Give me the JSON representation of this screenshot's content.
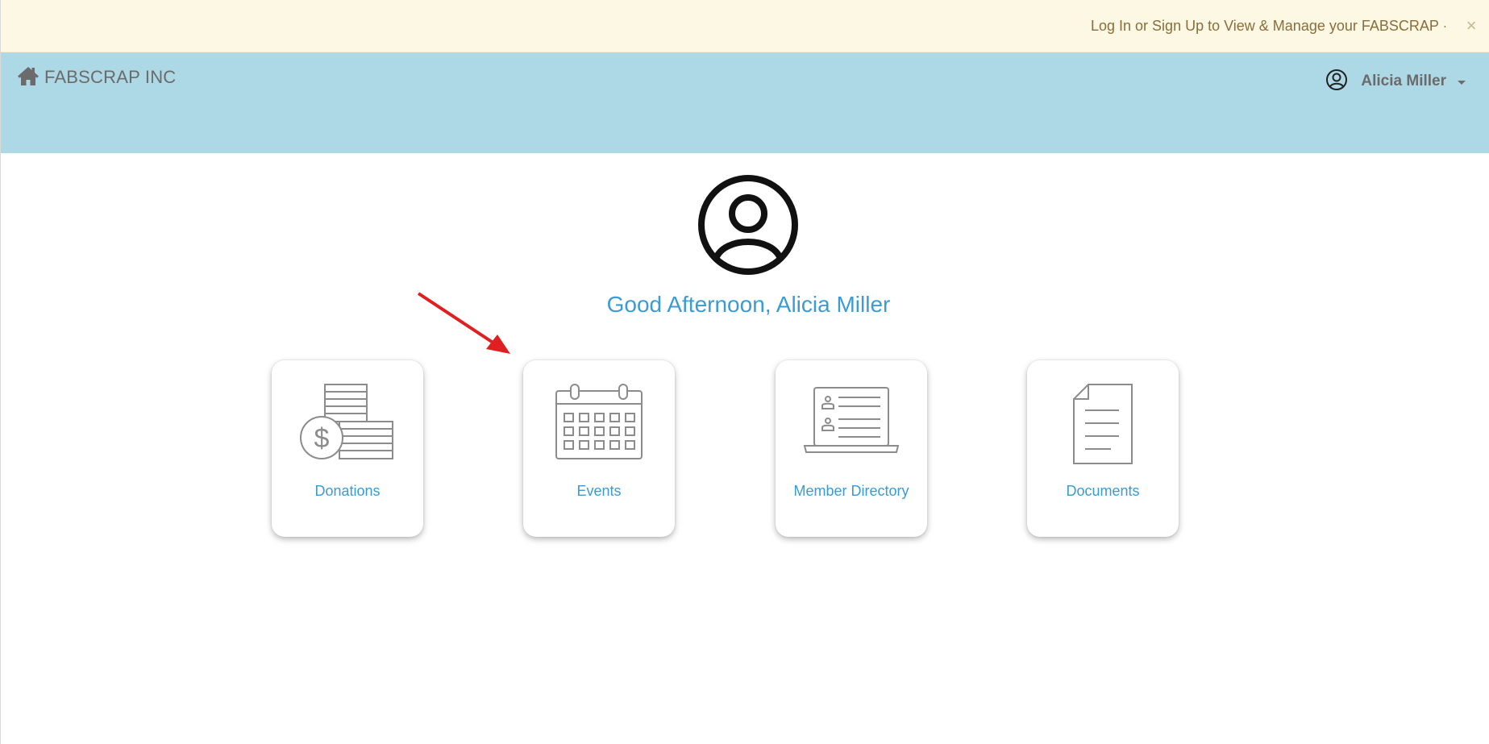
{
  "banner": {
    "message": "Log In or Sign Up to View & Manage your FABSCRAP ·",
    "close_label": "×"
  },
  "navbar": {
    "brand": "FABSCRAP INC",
    "brand_icon": "home-icon",
    "user": {
      "icon": "user-circle-icon",
      "name": "Alicia Miller"
    }
  },
  "main": {
    "avatar_icon": "user-circle-icon",
    "greeting": "Good Afternoon, Alicia Miller",
    "cards": [
      {
        "label": "Donations",
        "icon": "donations-icon"
      },
      {
        "label": "Events",
        "icon": "calendar-icon"
      },
      {
        "label": "Member Directory",
        "icon": "member-directory-icon"
      },
      {
        "label": "Documents",
        "icon": "document-icon"
      }
    ]
  },
  "colors": {
    "banner_bg": "#fcf8e3",
    "banner_text": "#8a6d3b",
    "navbar_bg": "#add8e6",
    "link": "#3a9bd5",
    "icon_gray": "#8c8c8c",
    "annotation_arrow": "#e02020"
  }
}
